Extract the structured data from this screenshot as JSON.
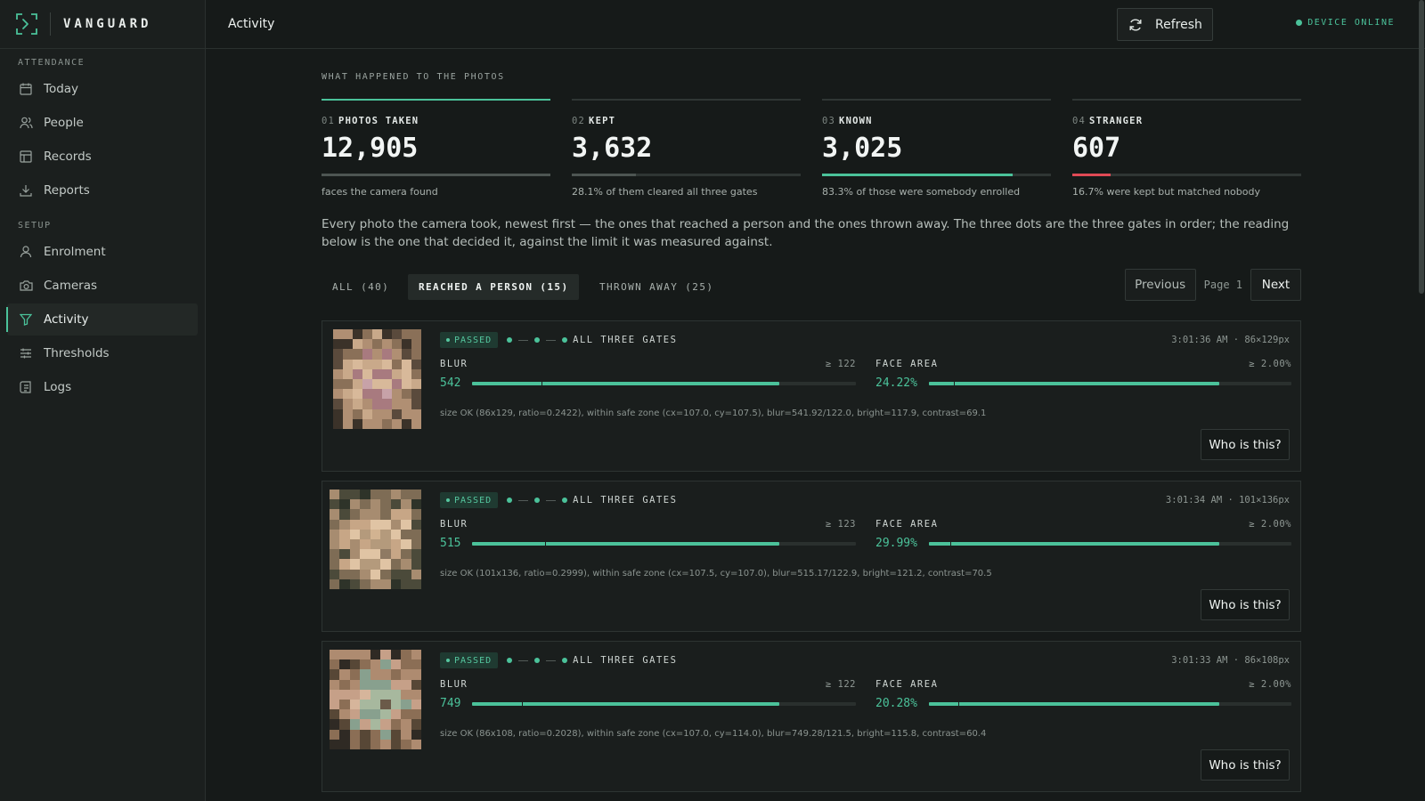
{
  "brand": {
    "name": "VANGUARD"
  },
  "sidebar": {
    "sections": [
      {
        "title": "ATTENDANCE",
        "items": [
          {
            "label": "Today",
            "icon": "calendar-icon"
          },
          {
            "label": "People",
            "icon": "people-icon"
          },
          {
            "label": "Records",
            "icon": "table-icon"
          },
          {
            "label": "Reports",
            "icon": "download-icon"
          }
        ]
      },
      {
        "title": "SETUP",
        "items": [
          {
            "label": "Enrolment",
            "icon": "person-icon"
          },
          {
            "label": "Cameras",
            "icon": "camera-icon"
          },
          {
            "label": "Activity",
            "icon": "filter-icon",
            "active": true
          },
          {
            "label": "Thresholds",
            "icon": "sliders-icon"
          },
          {
            "label": "Logs",
            "icon": "logs-icon"
          }
        ]
      }
    ]
  },
  "topbar": {
    "title": "Activity",
    "refresh_label": "Refresh",
    "status": "DEVICE ONLINE"
  },
  "colors": {
    "accent": "#4bc29a",
    "danger": "#e04a55",
    "muted_bar": "#4d5552"
  },
  "main": {
    "section_title": "WHAT HAPPENED TO THE PHOTOS",
    "stats": [
      {
        "num": "01",
        "label": "PHOTOS TAKEN",
        "value": "12,905",
        "caption": "faces the camera found",
        "fraction": 1.0,
        "color": "#4d5552"
      },
      {
        "num": "02",
        "label": "KEPT",
        "value": "3,632",
        "caption": "28.1% of them cleared all three gates",
        "fraction": 0.281,
        "color": "#4d5552"
      },
      {
        "num": "03",
        "label": "KNOWN",
        "value": "3,025",
        "caption": "83.3% of those were somebody enrolled",
        "fraction": 0.833,
        "color": "#4bc29a"
      },
      {
        "num": "04",
        "label": "STRANGER",
        "value": "607",
        "caption": "16.7% were kept but matched nobody",
        "fraction": 0.167,
        "color": "#e04a55"
      }
    ],
    "intro": "Every photo the camera took, newest first — the ones that reached a person and the ones thrown away. The three dots are the three gates in order; the reading below is the one that decided it, against the limit it was measured against.",
    "tabs": [
      {
        "label": "ALL (40)"
      },
      {
        "label": "REACHED A PERSON (15)",
        "active": true
      },
      {
        "label": "THROWN AWAY (25)"
      }
    ],
    "pager": {
      "prev": "Previous",
      "page": "Page 1",
      "next": "Next"
    },
    "records": [
      {
        "status": "PASSED",
        "gates_label": "ALL THREE GATES",
        "meta": "3:01:36 AM · 86×129px",
        "blur": {
          "name": "BLUR",
          "threshold": "≥ 122",
          "value": "542",
          "fraction": 0.8,
          "tick": 0.18
        },
        "area": {
          "name": "FACE AREA",
          "threshold": "≥ 2.00%",
          "value": "24.22%",
          "fraction": 0.8,
          "tick": 0.07
        },
        "note": "size OK (86x129, ratio=0.2422), within safe zone (cx=107.0, cy=107.5), blur=541.92/122.0, bright=117.9, contrast=69.1",
        "button": "Who is this?"
      },
      {
        "status": "PASSED",
        "gates_label": "ALL THREE GATES",
        "meta": "3:01:34 AM · 101×136px",
        "blur": {
          "name": "BLUR",
          "threshold": "≥ 123",
          "value": "515",
          "fraction": 0.8,
          "tick": 0.19
        },
        "area": {
          "name": "FACE AREA",
          "threshold": "≥ 2.00%",
          "value": "29.99%",
          "fraction": 0.8,
          "tick": 0.06
        },
        "note": "size OK (101x136, ratio=0.2999), within safe zone (cx=107.5, cy=107.0), blur=515.17/122.9, bright=121.2, contrast=70.5",
        "button": "Who is this?"
      },
      {
        "status": "PASSED",
        "gates_label": "ALL THREE GATES",
        "meta": "3:01:33 AM · 86×108px",
        "blur": {
          "name": "BLUR",
          "threshold": "≥ 122",
          "value": "749",
          "fraction": 0.8,
          "tick": 0.13
        },
        "area": {
          "name": "FACE AREA",
          "threshold": "≥ 2.00%",
          "value": "20.28%",
          "fraction": 0.8,
          "tick": 0.08
        },
        "note": "size OK (86x108, ratio=0.2028), within safe zone (cx=107.0, cy=114.0), blur=749.28/121.5, bright=115.8, contrast=60.4",
        "button": "Who is this?"
      }
    ]
  }
}
